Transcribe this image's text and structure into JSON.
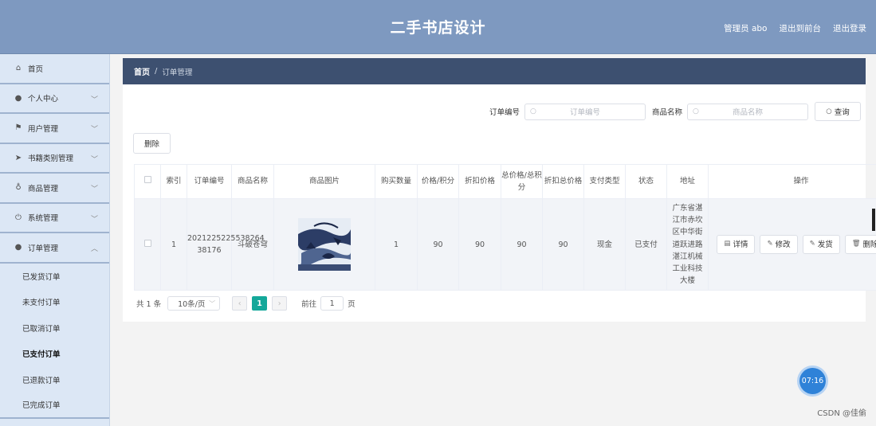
{
  "header": {
    "title": "二手书店设计",
    "admin": "管理员 abo",
    "back_to_front": "退出到前台",
    "logout": "退出登录"
  },
  "sidebar": {
    "items": [
      {
        "label": "首页",
        "icon": "home-icon"
      },
      {
        "label": "个人中心",
        "icon": "user-icon"
      },
      {
        "label": "用户管理",
        "icon": "flag-icon"
      },
      {
        "label": "书籍类别管理",
        "icon": "send-icon"
      },
      {
        "label": "商品管理",
        "icon": "bulb-icon"
      },
      {
        "label": "系统管理",
        "icon": "power-icon"
      },
      {
        "label": "订单管理",
        "icon": "user-icon"
      }
    ],
    "order_sub": [
      "已发货订单",
      "未支付订单",
      "已取消订单",
      "已支付订单",
      "已退款订单",
      "已完成订单"
    ]
  },
  "breadcrumb": {
    "home": "首页",
    "separator": "/",
    "current": "订单管理"
  },
  "search": {
    "order_no_label": "订单编号",
    "order_no_placeholder": "订单编号",
    "product_label": "商品名称",
    "product_placeholder": "商品名称",
    "query_button": "查询"
  },
  "delete_button": "删除",
  "table": {
    "headers": [
      "索引",
      "订单编号",
      "商品名称",
      "商品图片",
      "购买数量",
      "价格/积分",
      "折扣价格",
      "总价格/总积分",
      "折扣总价格",
      "支付类型",
      "状态",
      "地址",
      "操作"
    ],
    "rows": [
      {
        "index": "1",
        "order_no": "2021225225538264 38176",
        "product": "斗破苍穹",
        "qty": "1",
        "price": "90",
        "discount": "90",
        "total": "90",
        "discount_total": "90",
        "pay_type": "现金",
        "status": "已支付",
        "address": "广东省湛江市赤坎区中华街道跃进路湛江机械工业科技大楼"
      }
    ],
    "actions": {
      "detail": "详情",
      "edit": "修改",
      "ship": "发货",
      "delete": "删除"
    }
  },
  "pager": {
    "total": "共 1 条",
    "page_size": "10条/页",
    "current_page": "1",
    "goto_label": "前往",
    "goto_value": "1",
    "page_unit": "页"
  },
  "timer": "07:16",
  "watermark": "CSDN @佳偷",
  "colors": {
    "header_bg": "#7e99c0",
    "sidebar_bg": "#dce7f5",
    "crumb_bg": "#3d5070",
    "page_active": "#14a89a"
  }
}
